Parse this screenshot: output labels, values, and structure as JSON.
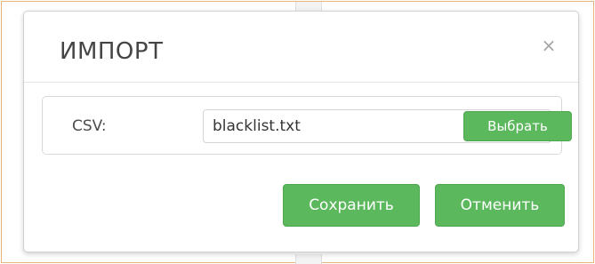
{
  "dialog": {
    "title": "ИМПОРТ",
    "close_icon": "close-icon",
    "close_glyph": "×"
  },
  "csv_field": {
    "label": "CSV:",
    "value": "blacklist.txt",
    "placeholder": "",
    "browse_label": "Выбрать"
  },
  "footer": {
    "save_label": "Сохранить",
    "cancel_label": "Отменить"
  },
  "colors": {
    "accent_green": "#5cb85c",
    "frame_border": "#e7b57c"
  }
}
